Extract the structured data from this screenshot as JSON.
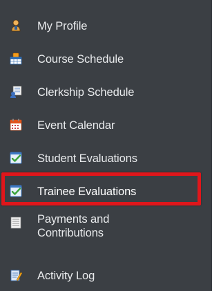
{
  "menu": {
    "items": [
      {
        "label": "My Profile",
        "icon": "user-icon"
      },
      {
        "label": "Course Schedule",
        "icon": "course-schedule-icon"
      },
      {
        "label": "Clerkship Schedule",
        "icon": "clerkship-schedule-icon"
      },
      {
        "label": "Event Calendar",
        "icon": "calendar-icon"
      },
      {
        "label": "Student Evaluations",
        "icon": "evaluation-check-icon"
      },
      {
        "label": "Trainee Evaluations",
        "icon": "evaluation-check-icon"
      },
      {
        "label": "Payments and Contributions",
        "icon": "payments-icon"
      },
      {
        "label": "Activity Log",
        "icon": "activity-log-icon"
      }
    ]
  },
  "colors": {
    "sidebar_background": "#3b3f44",
    "label_text": "#e9ebed",
    "highlight_border": "#e0161b"
  }
}
